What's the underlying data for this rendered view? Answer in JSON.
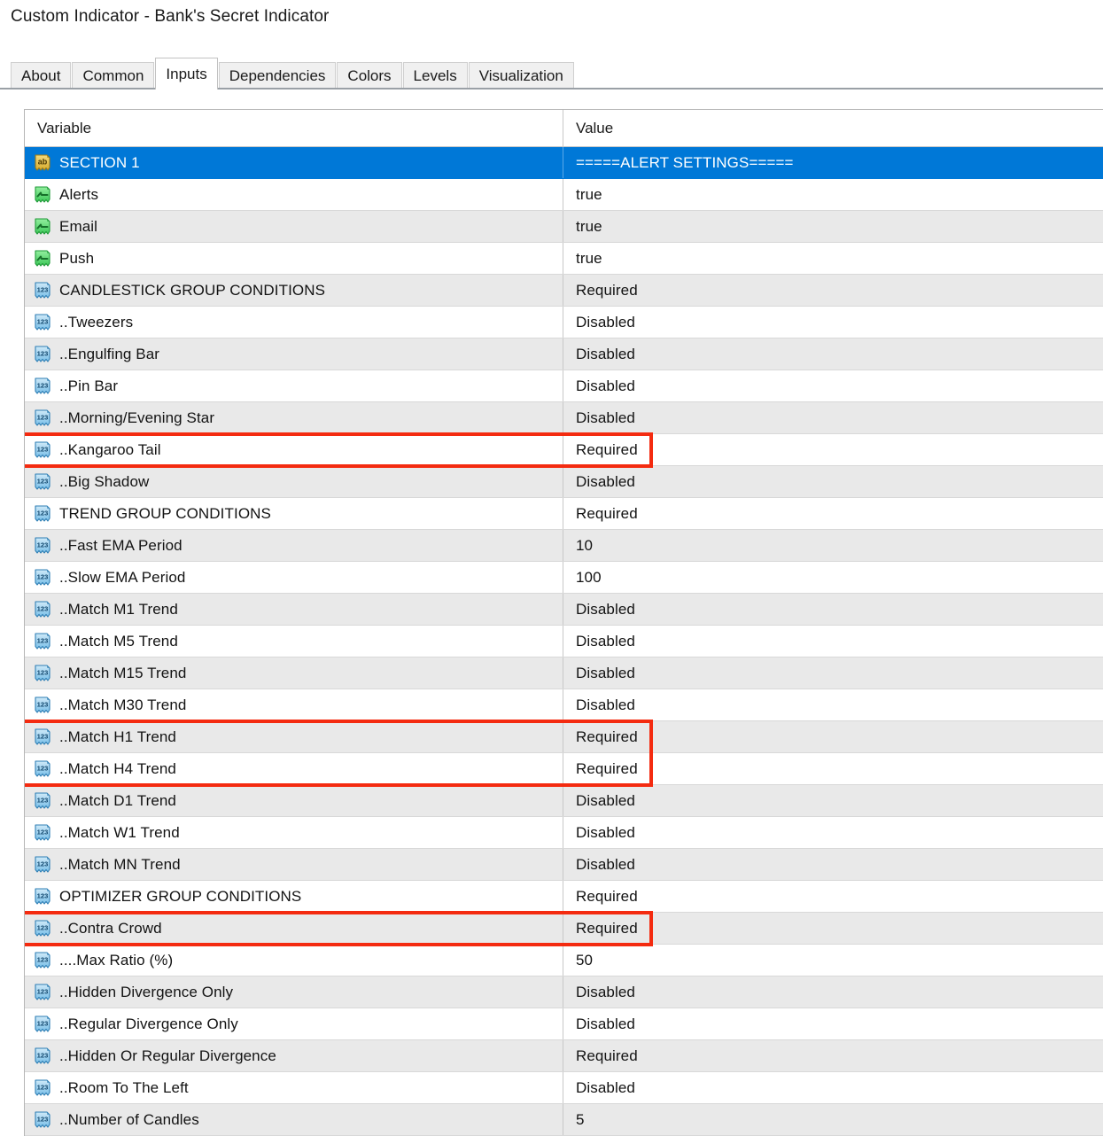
{
  "window": {
    "title": "Custom Indicator - Bank's Secret Indicator"
  },
  "tabs": [
    {
      "label": "About",
      "active": false
    },
    {
      "label": "Common",
      "active": false
    },
    {
      "label": "Inputs",
      "active": true
    },
    {
      "label": "Dependencies",
      "active": false
    },
    {
      "label": "Colors",
      "active": false
    },
    {
      "label": "Levels",
      "active": false
    },
    {
      "label": "Visualization",
      "active": false
    }
  ],
  "table": {
    "columns": [
      "Variable",
      "Value"
    ],
    "colors": {
      "selection": "#0078d7",
      "highlight_box": "#f42b10",
      "row_alt": "#e9e9e9",
      "icon_string": "#e8c54a",
      "icon_bool": "#57d36a",
      "icon_number": "#7fc3ec"
    },
    "rows": [
      {
        "icon": "string-param-icon",
        "label": "SECTION 1",
        "value": "=====ALERT SETTINGS=====",
        "selected": true,
        "highlight": false
      },
      {
        "icon": "bool-param-icon",
        "label": "Alerts",
        "value": "true",
        "selected": false,
        "highlight": false
      },
      {
        "icon": "bool-param-icon",
        "label": "Email",
        "value": "true",
        "selected": false,
        "highlight": false
      },
      {
        "icon": "bool-param-icon",
        "label": "Push",
        "value": "true",
        "selected": false,
        "highlight": false
      },
      {
        "icon": "number-param-icon",
        "label": "CANDLESTICK GROUP CONDITIONS",
        "value": "Required",
        "selected": false,
        "highlight": false
      },
      {
        "icon": "number-param-icon",
        "label": "..Tweezers",
        "value": "Disabled",
        "selected": false,
        "highlight": false
      },
      {
        "icon": "number-param-icon",
        "label": "..Engulfing Bar",
        "value": "Disabled",
        "selected": false,
        "highlight": false
      },
      {
        "icon": "number-param-icon",
        "label": "..Pin Bar",
        "value": "Disabled",
        "selected": false,
        "highlight": false
      },
      {
        "icon": "number-param-icon",
        "label": "..Morning/Evening Star",
        "value": "Disabled",
        "selected": false,
        "highlight": false
      },
      {
        "icon": "number-param-icon",
        "label": "..Kangaroo Tail",
        "value": "Required",
        "selected": false,
        "highlight": true
      },
      {
        "icon": "number-param-icon",
        "label": "..Big Shadow",
        "value": "Disabled",
        "selected": false,
        "highlight": false
      },
      {
        "icon": "number-param-icon",
        "label": "TREND GROUP CONDITIONS",
        "value": "Required",
        "selected": false,
        "highlight": false
      },
      {
        "icon": "number-param-icon",
        "label": "..Fast EMA Period",
        "value": "10",
        "selected": false,
        "highlight": false
      },
      {
        "icon": "number-param-icon",
        "label": "..Slow EMA Period",
        "value": "100",
        "selected": false,
        "highlight": false
      },
      {
        "icon": "number-param-icon",
        "label": "..Match M1 Trend",
        "value": "Disabled",
        "selected": false,
        "highlight": false
      },
      {
        "icon": "number-param-icon",
        "label": "..Match M5 Trend",
        "value": "Disabled",
        "selected": false,
        "highlight": false
      },
      {
        "icon": "number-param-icon",
        "label": "..Match M15 Trend",
        "value": "Disabled",
        "selected": false,
        "highlight": false
      },
      {
        "icon": "number-param-icon",
        "label": "..Match M30 Trend",
        "value": "Disabled",
        "selected": false,
        "highlight": false
      },
      {
        "icon": "number-param-icon",
        "label": "..Match H1 Trend",
        "value": "Required",
        "selected": false,
        "highlight": true
      },
      {
        "icon": "number-param-icon",
        "label": "..Match H4 Trend",
        "value": "Required",
        "selected": false,
        "highlight": true
      },
      {
        "icon": "number-param-icon",
        "label": "..Match D1 Trend",
        "value": "Disabled",
        "selected": false,
        "highlight": false
      },
      {
        "icon": "number-param-icon",
        "label": "..Match W1 Trend",
        "value": "Disabled",
        "selected": false,
        "highlight": false
      },
      {
        "icon": "number-param-icon",
        "label": "..Match MN Trend",
        "value": "Disabled",
        "selected": false,
        "highlight": false
      },
      {
        "icon": "number-param-icon",
        "label": "OPTIMIZER GROUP CONDITIONS",
        "value": "Required",
        "selected": false,
        "highlight": false
      },
      {
        "icon": "number-param-icon",
        "label": "..Contra Crowd",
        "value": "Required",
        "selected": false,
        "highlight": true
      },
      {
        "icon": "number-param-icon",
        "label": "....Max Ratio (%)",
        "value": "50",
        "selected": false,
        "highlight": false
      },
      {
        "icon": "number-param-icon",
        "label": "..Hidden Divergence Only",
        "value": "Disabled",
        "selected": false,
        "highlight": false
      },
      {
        "icon": "number-param-icon",
        "label": "..Regular Divergence Only",
        "value": "Disabled",
        "selected": false,
        "highlight": false
      },
      {
        "icon": "number-param-icon",
        "label": "..Hidden Or Regular Divergence",
        "value": "Required",
        "selected": false,
        "highlight": false
      },
      {
        "icon": "number-param-icon",
        "label": "..Room To The Left",
        "value": "Disabled",
        "selected": false,
        "highlight": false
      },
      {
        "icon": "number-param-icon",
        "label": "..Number of Candles",
        "value": "5",
        "selected": false,
        "highlight": false
      }
    ]
  }
}
